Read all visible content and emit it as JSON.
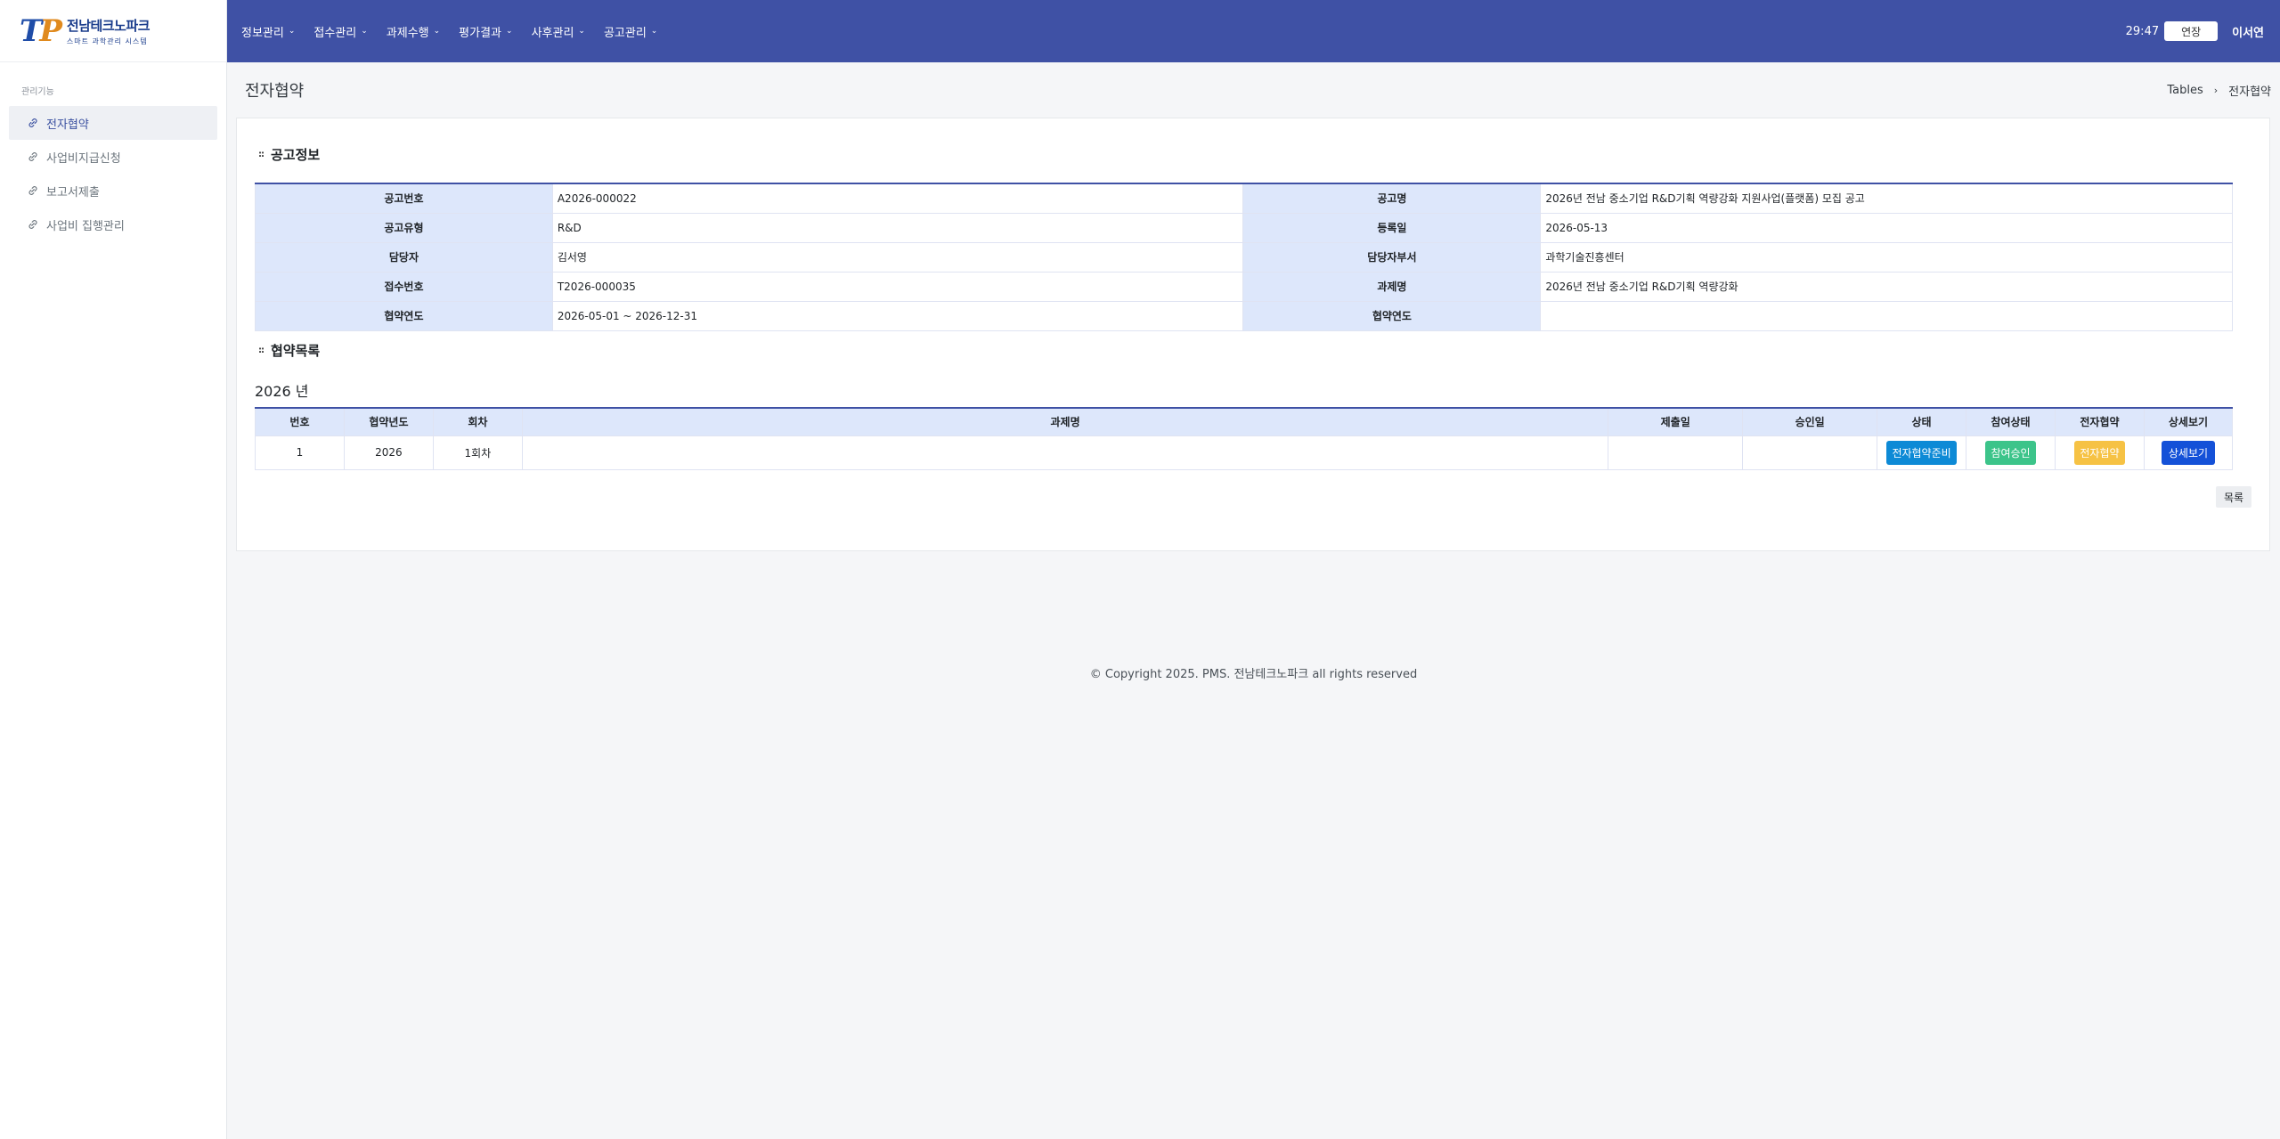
{
  "logo": {
    "mark_t": "T",
    "mark_p": "P",
    "main": "전남테크노파크",
    "sub": "스마트 과학관리 시스템"
  },
  "sidebar": {
    "section": "관리기능",
    "items": [
      {
        "label": "전자협약"
      },
      {
        "label": "사업비지급신청"
      },
      {
        "label": "보고서제출"
      },
      {
        "label": "사업비 집행관리"
      }
    ]
  },
  "topnav": {
    "items": [
      {
        "label": "정보관리"
      },
      {
        "label": "접수관리"
      },
      {
        "label": "과제수행"
      },
      {
        "label": "평가결과"
      },
      {
        "label": "사후관리"
      },
      {
        "label": "공고관리"
      }
    ],
    "timer": "29:47",
    "extend": "연장",
    "user": "이서연"
  },
  "page": {
    "title": "전자협약",
    "breadcrumb": [
      "Tables",
      "전자협약"
    ]
  },
  "notice": {
    "heading": "공고정보",
    "rows": [
      {
        "l1": "공고번호",
        "v1": "A2026-000022",
        "l2": "공고명",
        "v2": "2026년 전남 중소기업 R&D기획 역량강화 지원사업(플랫폼) 모집 공고"
      },
      {
        "l1": "공고유형",
        "v1": "R&D",
        "l2": "등록일",
        "v2": "2026-05-13"
      },
      {
        "l1": "담당자",
        "v1": "김서영",
        "l2": "담당자부서",
        "v2": "과학기술진흥센터"
      },
      {
        "l1": "접수번호",
        "v1": "T2026-000035",
        "l2": "과제명",
        "v2": "2026년 전남 중소기업 R&D기획 역량강화"
      },
      {
        "l1": "협약연도",
        "v1": "2026-05-01 ~ 2026-12-31",
        "l2": "협약연도",
        "v2": ""
      }
    ]
  },
  "agreements": {
    "heading": "협약목록",
    "year": "2026 년",
    "columns": [
      "번호",
      "협약년도",
      "회차",
      "과제명",
      "제출일",
      "승인일",
      "상태",
      "참여상태",
      "전자협약",
      "상세보기"
    ],
    "rows": [
      {
        "no": "1",
        "year": "2026",
        "round": "1회차",
        "title": "",
        "submitted": "",
        "approved": "",
        "status": "전자협약준비",
        "participation": "참여승인",
        "esign": "전자협약",
        "detail": "상세보기"
      }
    ],
    "list_button": "목록"
  },
  "footer": "© Copyright 2025. PMS. 전남테크노파크 all rights reserved",
  "colors": {
    "topbar": "#3f51a5",
    "header_cell": "#dde7fb",
    "status_blue": "#0d8ad6",
    "status_green": "#3cc48a",
    "status_yellow": "#f6c244",
    "detail_navy": "#1451d8"
  }
}
